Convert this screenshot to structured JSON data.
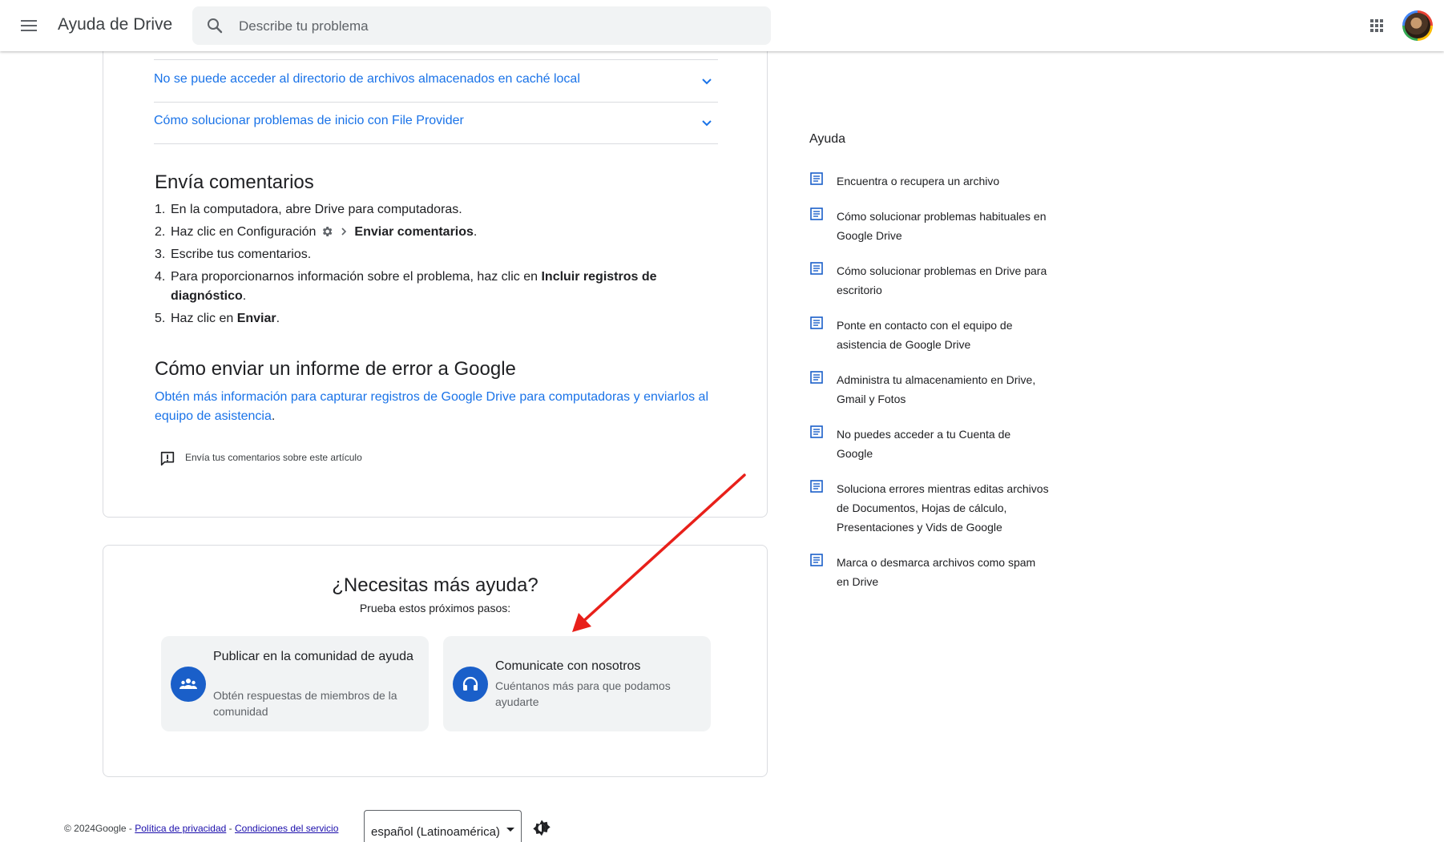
{
  "header": {
    "title": "Ayuda de Drive",
    "search_placeholder": "Describe tu problema"
  },
  "article": {
    "accordion": [
      {
        "label": "No se puede acceder al directorio de archivos almacenados en caché local"
      },
      {
        "label": "Cómo solucionar problemas de inicio con File Provider"
      }
    ],
    "feedback_section": {
      "title": "Envía comentarios",
      "steps": [
        {
          "num": "1.",
          "text": "En la computadora, abre Drive para computadoras."
        },
        {
          "num": "2.",
          "pre": "Haz clic en Configuración",
          "bold": "Enviar comentarios",
          "post": "."
        },
        {
          "num": "3.",
          "text": "Escribe tus comentarios."
        },
        {
          "num": "4.",
          "pre": "Para proporcionarnos información sobre el problema, haz clic en ",
          "bold": "Incluir registros de diagnóstico",
          "post": "."
        },
        {
          "num": "5.",
          "pre": "Haz clic en ",
          "bold": "Enviar",
          "post": "."
        }
      ]
    },
    "report_section": {
      "title": "Cómo enviar un informe de error a Google",
      "link": "Obtén más información para capturar registros de Google Drive para computadoras y enviarlos al equipo de asistencia",
      "link_suffix": "."
    },
    "feedback_link": "Envía tus comentarios sobre este artículo"
  },
  "help": {
    "title": "¿Necesitas más ayuda?",
    "subtitle": "Prueba estos próximos pasos:",
    "options": [
      {
        "title": "Publicar en la comunidad de ayuda",
        "description": "Obtén respuestas de miembros de la comunidad"
      },
      {
        "title": "Comunicate con nosotros",
        "description": "Cuéntanos más para que podamos ayudarte"
      }
    ]
  },
  "sidebar": {
    "title": "Ayuda",
    "items": [
      {
        "label": "Encuentra o recupera un archivo"
      },
      {
        "label": "Cómo solucionar problemas habituales en Google Drive"
      },
      {
        "label": "Cómo solucionar problemas en Drive para escritorio",
        "active": true
      },
      {
        "label": "Ponte en contacto con el equipo de asistencia de Google Drive"
      },
      {
        "label": "Administra tu almacenamiento en Drive, Gmail y Fotos"
      },
      {
        "label": "No puedes acceder a tu Cuenta de Google"
      },
      {
        "label": "Soluciona errores mientras editas archivos de Documentos, Hojas de cálculo, Presentaciones y Vids de Google"
      },
      {
        "label": "Marca o desmarca archivos como spam en Drive"
      }
    ]
  },
  "footer": {
    "copyright": "© 2024Google",
    "dash": " - ",
    "privacy": "Política de privacidad",
    "terms": "Condiciones del servicio",
    "language": "español (Latinoamérica)"
  },
  "colors": {
    "link": "#1a73e8",
    "icon_blue": "#1a5fc9",
    "annotation_arrow": "#e8201a"
  }
}
